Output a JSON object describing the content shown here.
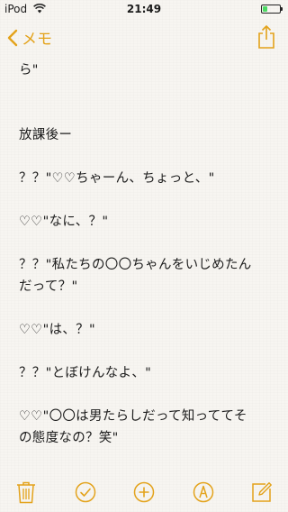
{
  "status_bar": {
    "carrier": "iPod",
    "time": "21:49",
    "battery_level": 0.25,
    "battery_color": "#4cd964"
  },
  "nav": {
    "back_label": "メモ",
    "accent_color": "#e3a21a",
    "back_icon": "chevron-left-icon",
    "share_icon": "share-icon"
  },
  "note": {
    "lines": [
      "ら\"",
      "",
      "",
      "放課後ー",
      "",
      "？？\"♡♡ちゃーん、ちょっと、\"",
      "",
      "♡♡\"なに、？\"",
      "",
      "？？\"私たちの〇〇ちゃんをいじめたん",
      "だって？\"",
      "",
      "♡♡\"は、？\"",
      "",
      "？？\"とぼけんなよ、\"",
      "",
      "♡♡\"〇〇は男たらしだって知っててそ",
      "の態度なの？笑\""
    ]
  },
  "toolbar": {
    "icons": [
      "trash-icon",
      "checklist-icon",
      "add-icon",
      "markup-icon",
      "compose-icon"
    ]
  }
}
